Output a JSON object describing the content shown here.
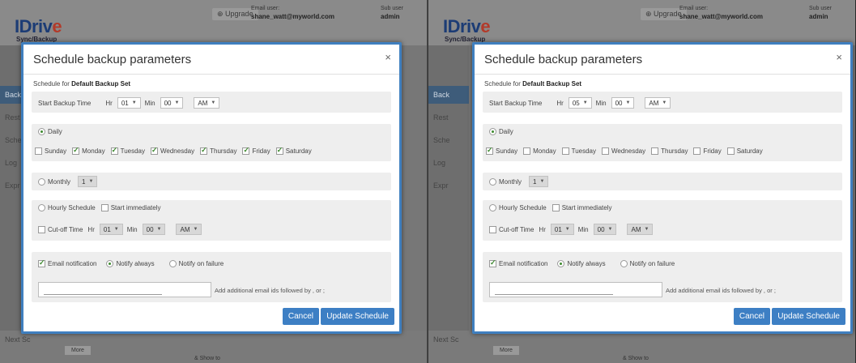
{
  "app": {
    "logo_text": "IDriv",
    "logo_e": "e",
    "logo_sub": "Sync/Backup",
    "upgrade": "Upgrade",
    "email_label": "Email user:",
    "email": "shane_watt@myworld.com",
    "user_label": "Sub user",
    "user": "admin"
  },
  "sidebar": {
    "items": [
      "Back",
      "Rest",
      "Sche",
      "Log",
      "Expr"
    ]
  },
  "bottom": {
    "next_label": "Next Sc",
    "more": "More",
    "show": "& Show to"
  },
  "modal": {
    "title": "Schedule backup parameters",
    "close": "×",
    "schedule_for_prefix": "Schedule for",
    "schedule_for_set": "Default Backup Set",
    "start_time_label": "Start Backup Time",
    "hr_label": "Hr",
    "min_label": "Min",
    "daily_label": "Daily",
    "monthly_label": "Monthly",
    "monthly_value": "1",
    "hourly_label": "Hourly Schedule",
    "start_immediately_label": "Start immediately",
    "cutoff_label": "Cut-off Time",
    "cutoff_hr": "01",
    "cutoff_min": "00",
    "cutoff_ampm": "AM",
    "email_notification_label": "Email notification",
    "notify_always_label": "Notify always",
    "notify_failure_label": "Notify on failure",
    "email_hint": "Add additional email ids followed by , or ;",
    "cancel": "Cancel",
    "update": "Update Schedule",
    "days": [
      "Sunday",
      "Monday",
      "Tuesday",
      "Wednesday",
      "Thursday",
      "Friday",
      "Saturday"
    ]
  },
  "panes": [
    {
      "hr": "01",
      "min": "00",
      "ampm": "AM",
      "day_checked": [
        false,
        true,
        true,
        true,
        true,
        true,
        true
      ]
    },
    {
      "hr": "05",
      "min": "00",
      "ampm": "AM",
      "day_checked": [
        true,
        false,
        false,
        false,
        false,
        false,
        false
      ]
    }
  ],
  "colors": {
    "accent": "#3d7fc4",
    "check": "#3d8a2e",
    "modal_border": "#3f7fbf"
  }
}
